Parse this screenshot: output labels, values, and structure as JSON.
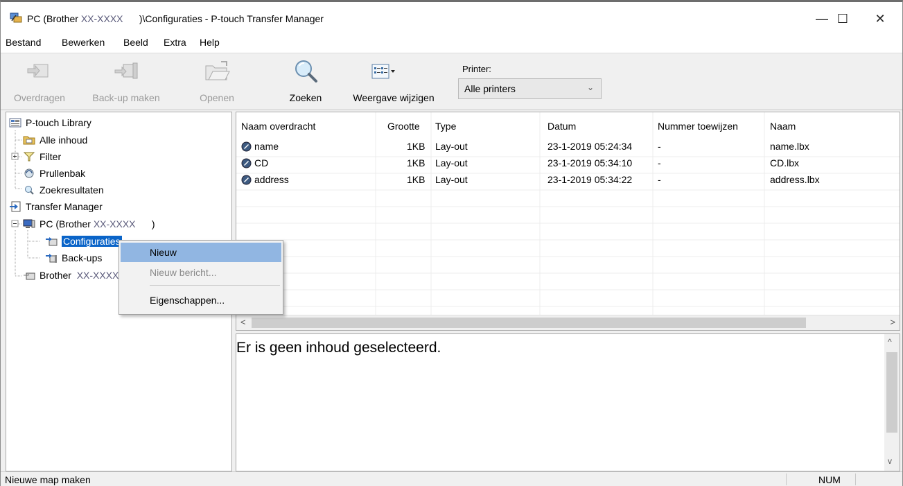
{
  "window": {
    "title_prefix": "PC (Brother ",
    "title_model": "XX-XXXX",
    "title_suffix": "      )\\Configuraties - P-touch Transfer Manager",
    "controls": {
      "minimize": "—",
      "maximize": "☐",
      "close": "✕"
    }
  },
  "menu": {
    "items": [
      "Bestand",
      "Bewerken",
      "Beeld",
      "Extra",
      "Help"
    ]
  },
  "toolbar": {
    "buttons": [
      {
        "label": "Overdragen",
        "icon": "transfer-icon",
        "enabled": false
      },
      {
        "label": "Back-up maken",
        "icon": "backup-icon",
        "enabled": false
      },
      {
        "label": "Openen",
        "icon": "open-folder-icon",
        "enabled": false
      },
      {
        "label": "Zoeken",
        "icon": "magnifier-icon",
        "enabled": true
      },
      {
        "label": "Weergave wijzigen",
        "icon": "view-icon",
        "enabled": true
      }
    ],
    "printer_label": "Printer:",
    "printer_value": "Alle printers"
  },
  "tree": {
    "library": "P-touch Library",
    "all_content": "Alle inhoud",
    "filter": "Filter",
    "trash": "Prullenbak",
    "search_results": "Zoekresultaten",
    "transfer_manager": "Transfer Manager",
    "pc_prefix": "PC (Brother ",
    "pc_model": "XX-XXXX",
    "pc_suffix": "      )",
    "configurations": "Configuraties",
    "backups": "Back-ups",
    "brother_prefix": "Brother  ",
    "brother_model": "XX-XXXX"
  },
  "list": {
    "columns": [
      "Naam overdracht",
      "Grootte",
      "Type",
      "Datum",
      "Nummer toewijzen",
      "Naam"
    ],
    "rows": [
      {
        "name": "name",
        "size": "1KB",
        "type": "Lay-out",
        "date": "23-1-2019 05:24:34",
        "number": "-",
        "file": "name.lbx"
      },
      {
        "name": "CD",
        "size": "1KB",
        "type": "Lay-out",
        "date": "23-1-2019 05:34:10",
        "number": "-",
        "file": "CD.lbx"
      },
      {
        "name": "address",
        "size": "1KB",
        "type": "Lay-out",
        "date": "23-1-2019 05:34:22",
        "number": "-",
        "file": "address.lbx"
      }
    ],
    "scroll_left": "<",
    "scroll_right": ">"
  },
  "preview": {
    "message": "Er is geen inhoud geselecteerd.",
    "scroll_up": "^",
    "scroll_down": "v"
  },
  "status": {
    "text": "Nieuwe map maken",
    "num": "NUM"
  },
  "context_menu": {
    "items": [
      {
        "label": "Nieuw",
        "state": "highlighted"
      },
      {
        "label": "Nieuw bericht...",
        "state": "disabled"
      },
      {
        "label": "Eigenschappen...",
        "state": "normal"
      }
    ]
  },
  "colors": {
    "selection": "#0a64c8",
    "menu_highlight": "#91b6e2"
  }
}
